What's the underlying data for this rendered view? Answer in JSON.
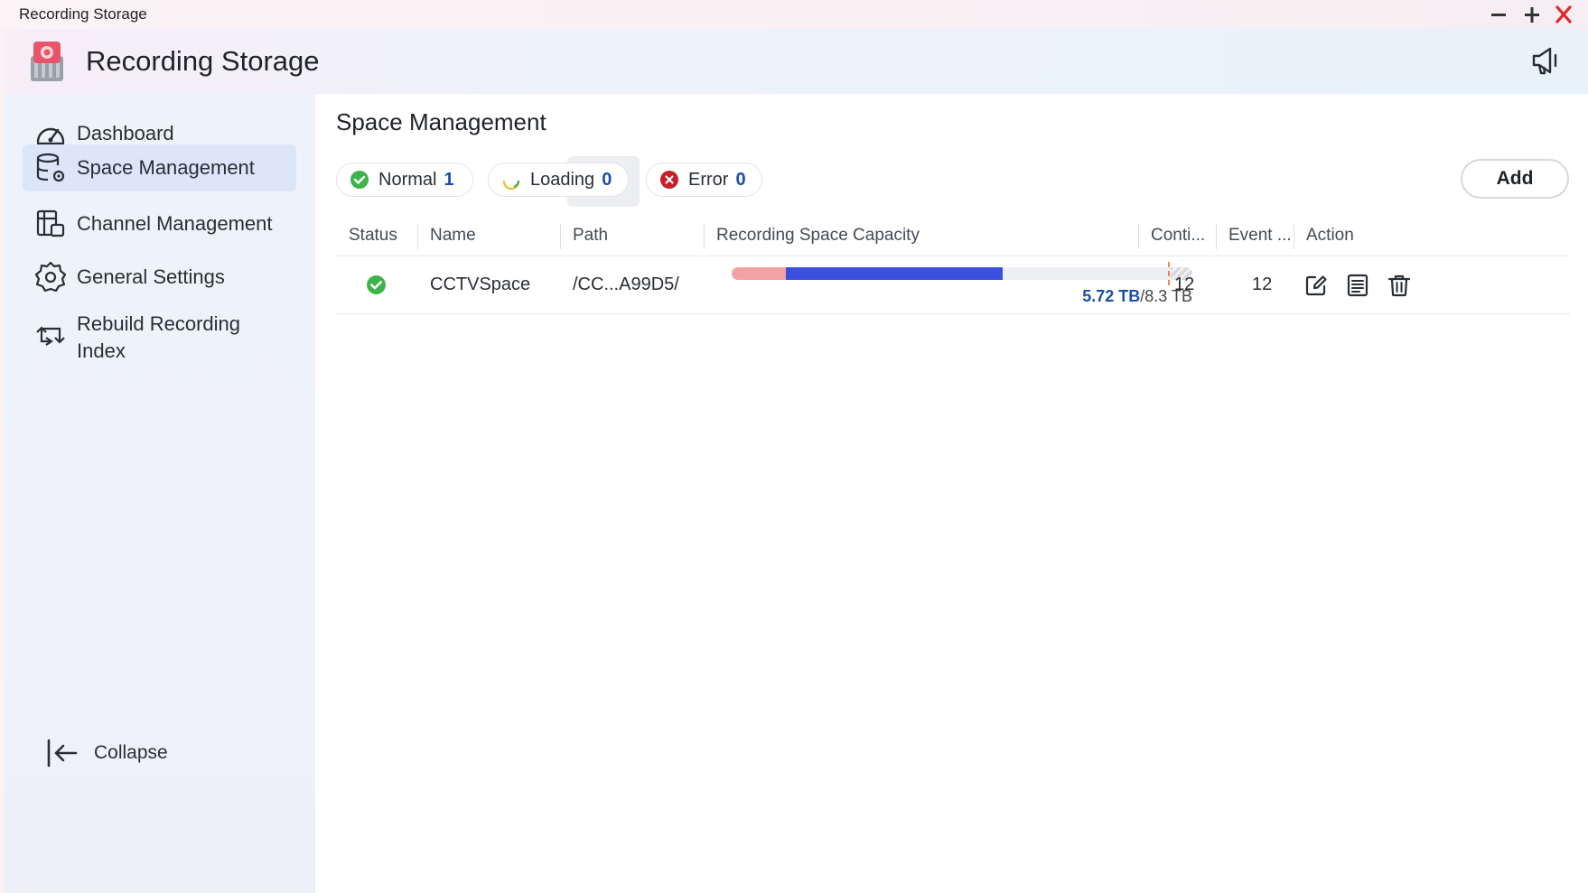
{
  "window": {
    "title": "Recording Storage",
    "controls": [
      "minimize-icon",
      "maximize-icon",
      "close-icon"
    ]
  },
  "header": {
    "app_title": "Recording Storage",
    "logo_icon": "recording-storage-logo-icon",
    "announce_icon": "megaphone-icon"
  },
  "sidebar": {
    "items": [
      {
        "label": "Dashboard",
        "icon": "gauge-icon",
        "active": false
      },
      {
        "label": "Space Management",
        "icon": "database-gear-icon",
        "active": true
      },
      {
        "label": "Channel Management",
        "icon": "channel-list-icon",
        "active": false
      },
      {
        "label": "General Settings",
        "icon": "gear-icon",
        "active": false
      },
      {
        "label": "Rebuild Recording Index",
        "icon": "rebuild-icon",
        "active": false
      }
    ],
    "collapse_label": "Collapse"
  },
  "main": {
    "title": "Space Management",
    "filters": [
      {
        "label": "Normal",
        "count": "1",
        "icon": "check-circle-icon"
      },
      {
        "label": "Loading",
        "count": "0",
        "icon": "spinner-icon"
      },
      {
        "label": "Error",
        "count": "0",
        "icon": "x-circle-icon"
      }
    ],
    "add_label": "Add",
    "table": {
      "columns": [
        "Status",
        "Name",
        "Path",
        "Recording Space Capacity",
        "Conti...",
        "Event ...",
        "Action"
      ],
      "rows": [
        {
          "status": "normal",
          "name": "CCTVSpace",
          "path": "/CC...A99D5/",
          "capacity_used": "5.72 TB",
          "capacity_total": "/8.3 TB",
          "capacity_seg1_fraction": 0.117,
          "capacity_seg2_fraction": 0.47,
          "continuous": "12",
          "event": "12",
          "actions": [
            "edit-icon",
            "list-icon",
            "trash-icon"
          ]
        }
      ]
    }
  },
  "colors": {
    "accent": "#1d4ea8",
    "ok": "#3cb44b",
    "error": "#d32626",
    "bar_blue": "#3b4fe0",
    "bar_pink": "#f2a2a5"
  }
}
